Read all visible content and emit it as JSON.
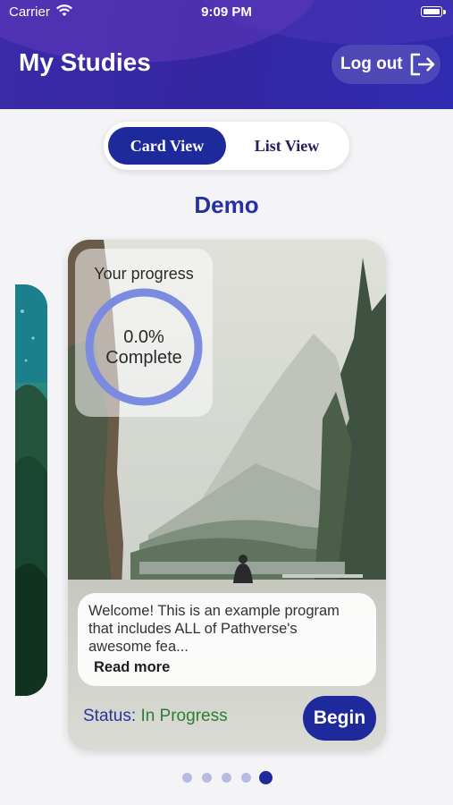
{
  "status_bar": {
    "carrier": "Carrier",
    "time": "9:09 PM"
  },
  "header": {
    "title": "My Studies",
    "logout_label": "Log out"
  },
  "view_toggle": {
    "card_label": "Card View",
    "list_label": "List View",
    "selected": "Card View"
  },
  "section": {
    "title": "Demo"
  },
  "study_card": {
    "progress_label": "Your progress",
    "progress_percent": "0.0%",
    "progress_complete": "Complete",
    "progress_value": 0.0,
    "description": "Welcome! This is an example program that includes ALL of Pathverse's awesome fea...",
    "read_more": "Read more",
    "status_key": "Status:",
    "status_value": "In Progress",
    "begin_label": "Begin"
  },
  "pagination": {
    "count": 5,
    "active_index": 4
  },
  "colors": {
    "accent": "#1e2a9c",
    "header": "#3526a2",
    "status_in_progress": "#2e7d32",
    "ring": "#7b8be0"
  }
}
